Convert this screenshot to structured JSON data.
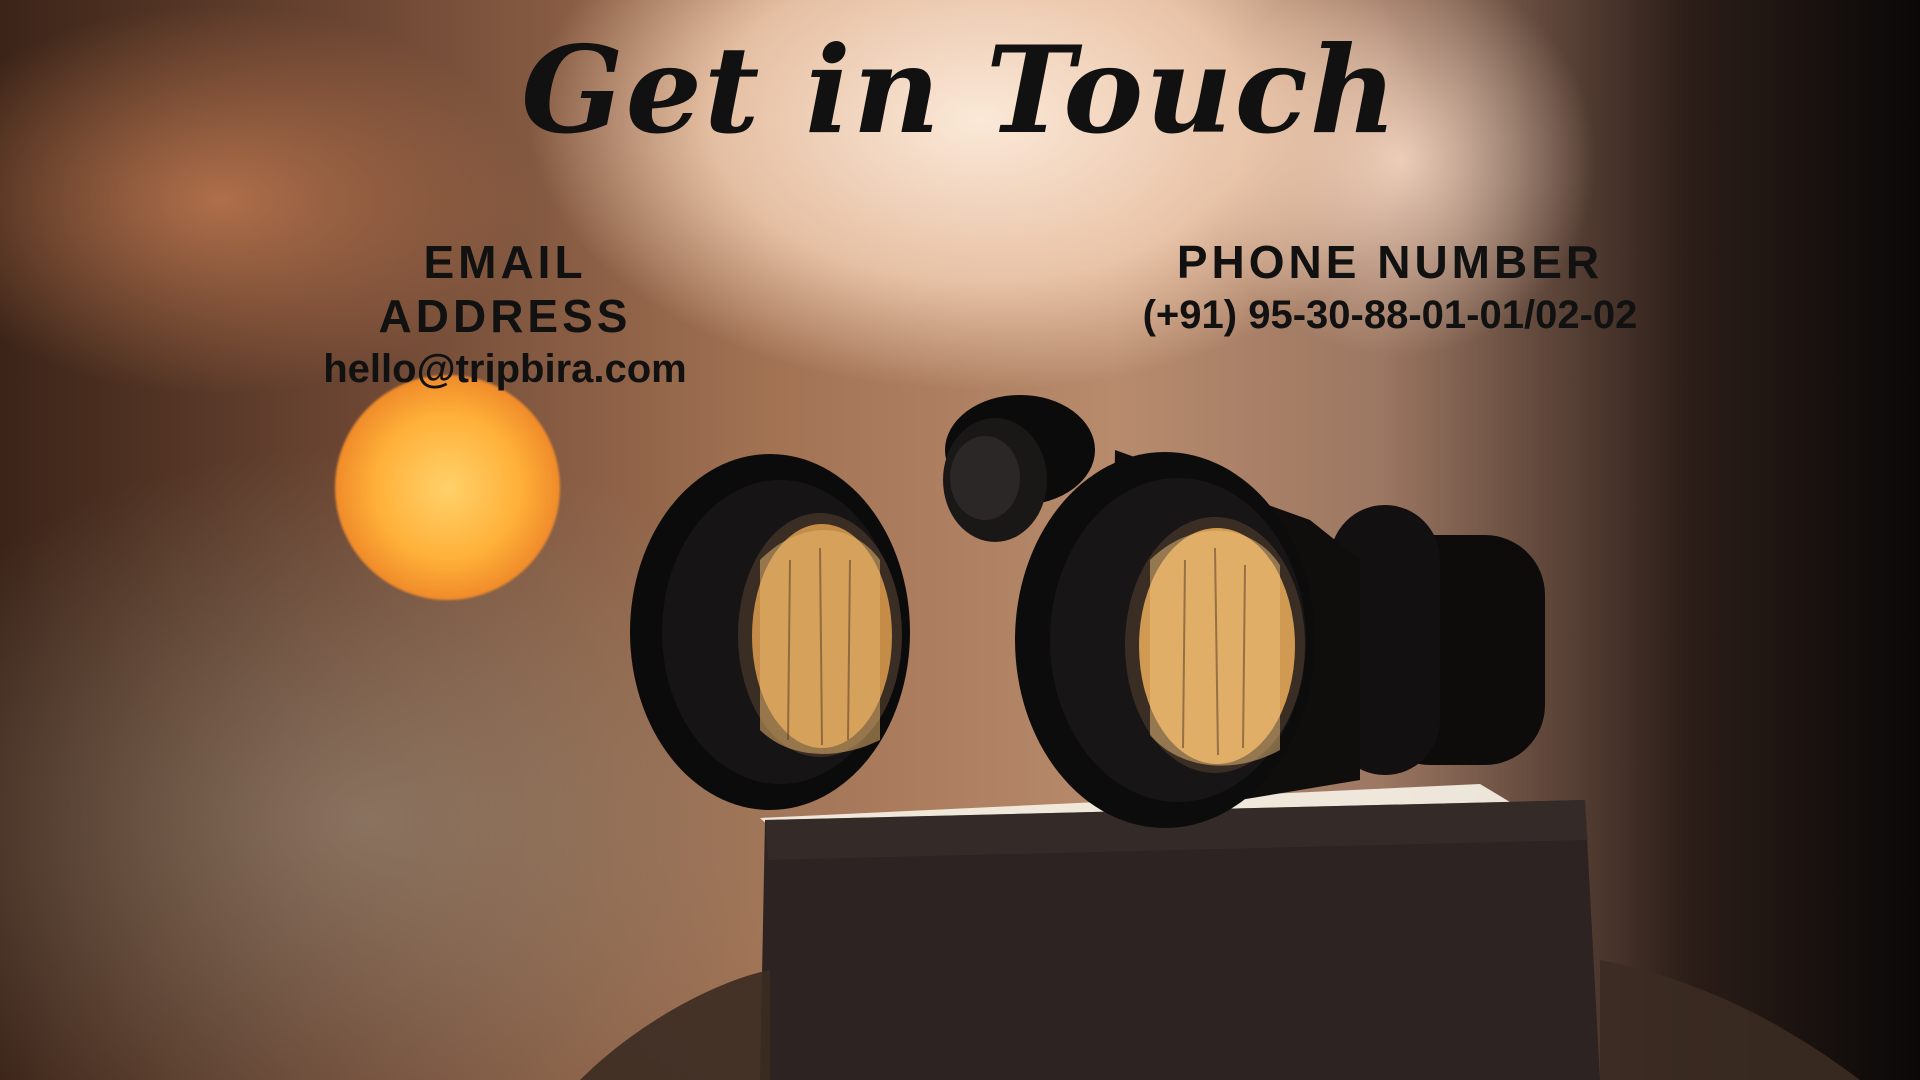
{
  "header": {
    "title": "Get in Touch"
  },
  "contacts": {
    "email": {
      "label": "EMAIL ADDRESS",
      "value": "hello@tripbira.com"
    },
    "phone": {
      "label": "PHONE NUMBER",
      "value": "(+91) 95-30-88-01-01/02-02"
    }
  },
  "colors": {
    "text": "#111111",
    "sun": "#ffb13a",
    "background_warm": "#b88b6d",
    "background_dark": "#0a0807"
  },
  "icons": [
    "binoculars-photo",
    "sun-bokeh"
  ]
}
